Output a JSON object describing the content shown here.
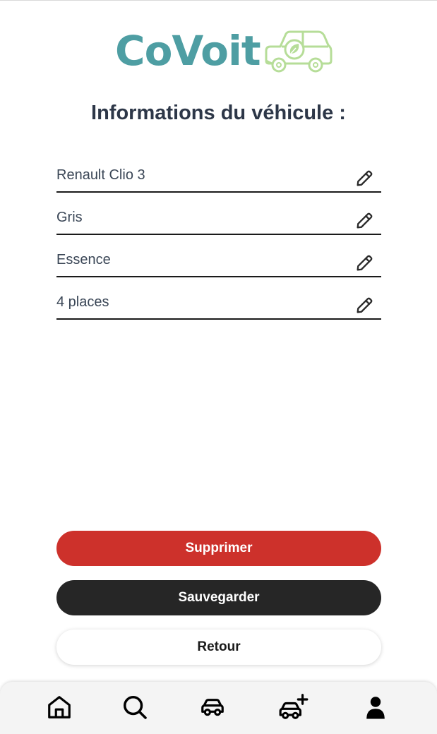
{
  "brand": {
    "name": "CoVoit",
    "text_color": "#4e9ea3",
    "car_color": "#b6dd98"
  },
  "page_title": "Informations du véhicule :",
  "vehicle_fields": [
    {
      "value": "Renault Clio 3",
      "icon": "pencil-icon"
    },
    {
      "value": "Gris",
      "icon": "pencil-icon"
    },
    {
      "value": "Essence",
      "icon": "pencil-icon"
    },
    {
      "value": "4 places",
      "icon": "pencil-icon"
    }
  ],
  "actions": {
    "delete_label": "Supprimer",
    "save_label": "Sauvegarder",
    "back_label": "Retour"
  },
  "colors": {
    "delete": "#cd312b",
    "save": "#262626",
    "back": "#ffffff"
  },
  "bottom_nav": [
    {
      "icon": "home-icon"
    },
    {
      "icon": "search-icon"
    },
    {
      "icon": "car-icon"
    },
    {
      "icon": "add-car-icon"
    },
    {
      "icon": "user-icon"
    }
  ]
}
